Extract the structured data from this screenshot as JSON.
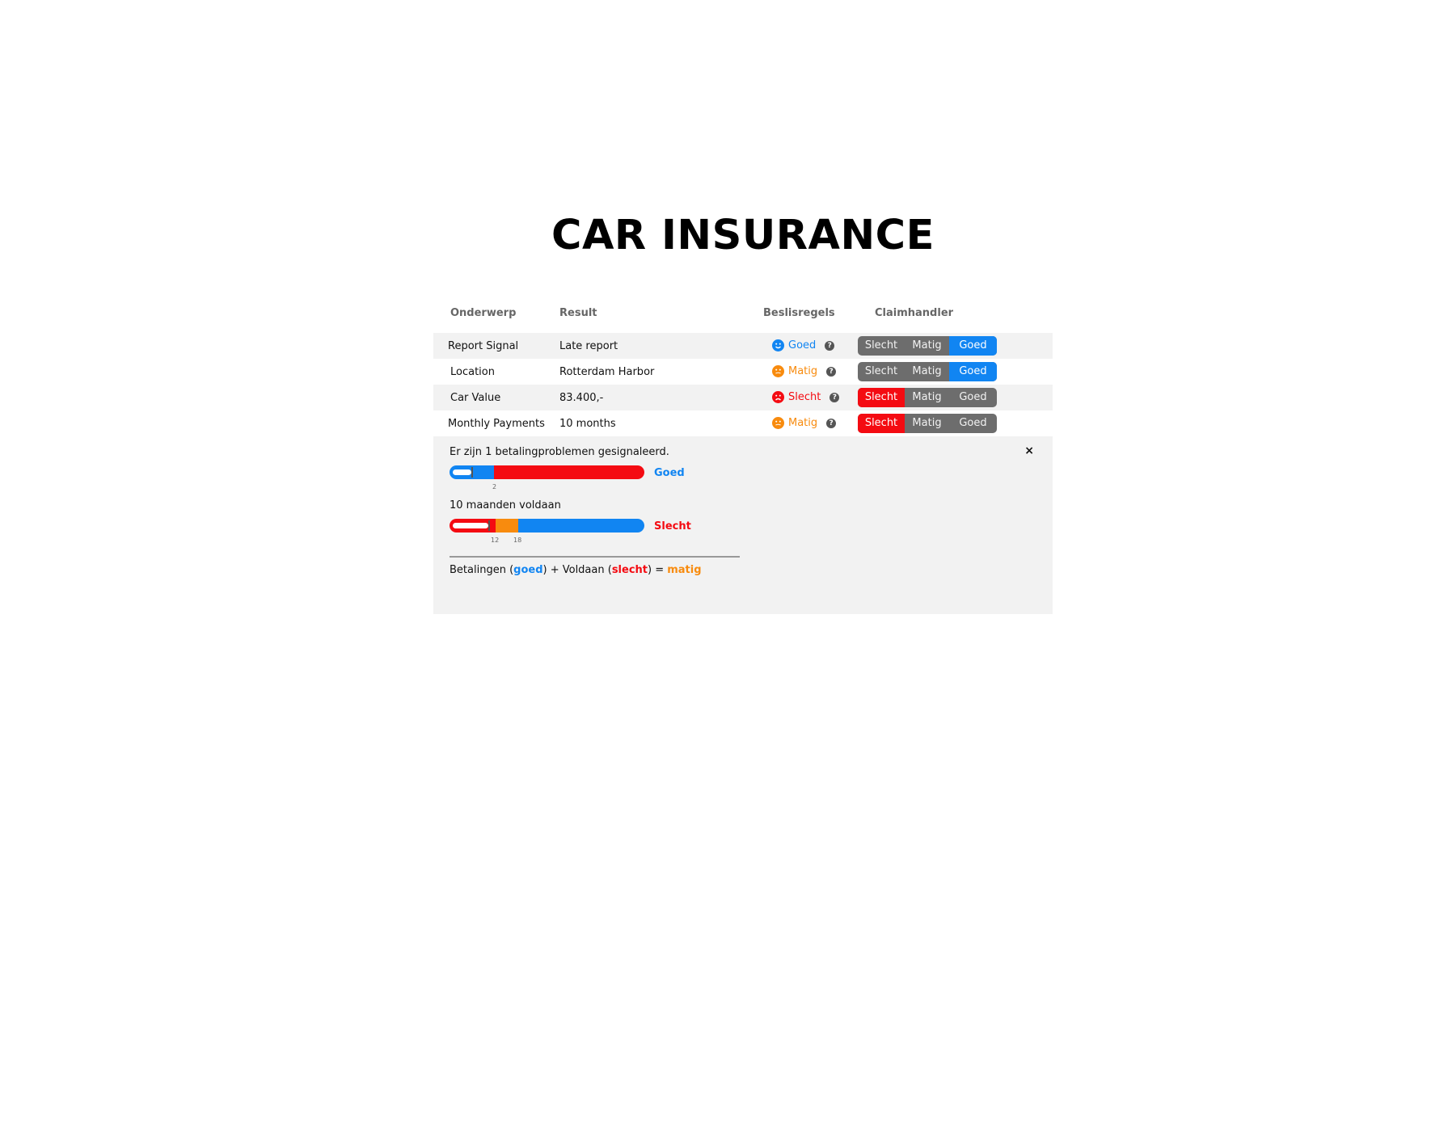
{
  "title": "CAR INSURANCE",
  "columns": {
    "onderwerp": "Onderwerp",
    "result": "Result",
    "beslisregels": "Beslisregels",
    "claimhandler": "Claimhandler"
  },
  "colors": {
    "goed": "#1185f2",
    "matig": "#f88b0e",
    "slecht": "#f40b12",
    "segment_inactive": "#6d6d6d",
    "row_alt": "#f2f2f2"
  },
  "rows": [
    {
      "subject": "Report Signal",
      "result": "Late report",
      "rule": "Goed",
      "rule_icon": "happy-face-icon",
      "segments": [
        "Slecht",
        "Matig",
        "Goed"
      ],
      "selected": "Goed"
    },
    {
      "subject": "Location",
      "result": "Rotterdam Harbor",
      "rule": "Matig",
      "rule_icon": "neutral-face-icon",
      "segments": [
        "Slecht",
        "Matig",
        "Goed"
      ],
      "selected": "Goed"
    },
    {
      "subject": "Car Value",
      "result": "83.400,-",
      "rule": "Slecht",
      "rule_icon": "sad-face-icon",
      "segments": [
        "Slecht",
        "Matig",
        "Goed"
      ],
      "selected": "Slecht"
    },
    {
      "subject": "Monthly Payments",
      "result": "10 months",
      "rule": "Matig",
      "rule_icon": "neutral-face-icon",
      "segments": [
        "Slecht",
        "Matig",
        "Goed"
      ],
      "selected": "Slecht"
    }
  ],
  "help_glyph": "?",
  "close_glyph": "×",
  "detail": {
    "payments_text": "Er zijn 1 betalingproblemen gesignaleerd.",
    "payments_value": 1,
    "payments_threshold_label": "2",
    "payments_result": "Goed",
    "voldaan_text": "10 maanden voldaan",
    "voldaan_value": 10,
    "voldaan_threshold_low": "12",
    "voldaan_threshold_high": "18",
    "voldaan_result": "Slecht",
    "formula": {
      "part1": "Betalingen (",
      "part1_val": "goed",
      "part2": ") + Voldaan (",
      "part2_val": "slecht",
      "part3": ") = ",
      "part3_val": "matig"
    }
  }
}
